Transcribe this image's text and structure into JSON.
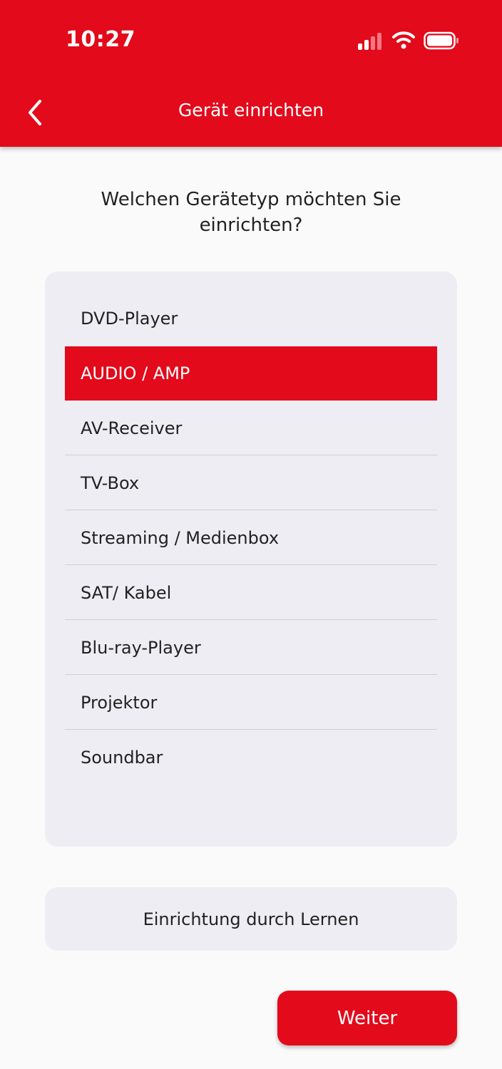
{
  "status_bar": {
    "time": "10:27",
    "icons": [
      "signal-icon",
      "wifi-icon",
      "battery-icon"
    ]
  },
  "header": {
    "title": "Gerät einrichten",
    "back_icon": "chevron-left-icon"
  },
  "question": "Welchen Gerätetyp möchten Sie einrichten?",
  "devices": [
    {
      "label": "DVD-Player",
      "selected": false
    },
    {
      "label": "AUDIO / AMP",
      "selected": true
    },
    {
      "label": "AV-Receiver",
      "selected": false
    },
    {
      "label": "TV-Box",
      "selected": false
    },
    {
      "label": "Streaming / Medienbox",
      "selected": false
    },
    {
      "label": "SAT/ Kabel",
      "selected": false
    },
    {
      "label": "Blu-ray-Player",
      "selected": false
    },
    {
      "label": "Projektor",
      "selected": false
    },
    {
      "label": "Soundbar",
      "selected": false
    }
  ],
  "learn_button": "Einrichtung durch Lernen",
  "next_button": "Weiter",
  "colors": {
    "accent": "#e20a1b",
    "list_background": "#eeedf3",
    "page_background": "#fafafa"
  }
}
